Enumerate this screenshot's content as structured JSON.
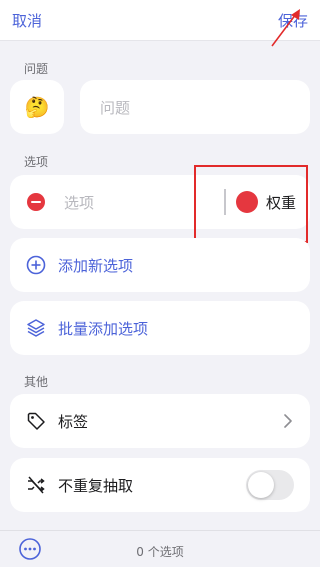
{
  "header": {
    "cancel_label": "取消",
    "save_label": "保存"
  },
  "question_section": {
    "label": "问题",
    "emoji": "🤔",
    "placeholder": "问题"
  },
  "options_section": {
    "label": "选项",
    "option_placeholder": "选项",
    "weight_label": "权重",
    "weight_color": "#e5373f"
  },
  "actions": {
    "add_option_label": "添加新选项",
    "batch_add_label": "批量添加选项"
  },
  "other_section": {
    "label": "其他",
    "tags_label": "标签",
    "no_repeat_label": "不重复抽取",
    "no_repeat_enabled": false
  },
  "footer": {
    "count_text": "0 个选项"
  },
  "colors": {
    "accent": "#4c63d9",
    "danger": "#e5373f",
    "annotation": "#e22a2a"
  },
  "icons": {
    "arrow": "red-arrow-annotation-icon",
    "remove": "minus-circle-icon",
    "add": "plus-circle-icon",
    "batch": "layers-icon",
    "tag": "tag-icon",
    "no_repeat": "shuffle-off-icon",
    "chevron": "chevron-right-icon",
    "more": "more-circle-icon"
  }
}
